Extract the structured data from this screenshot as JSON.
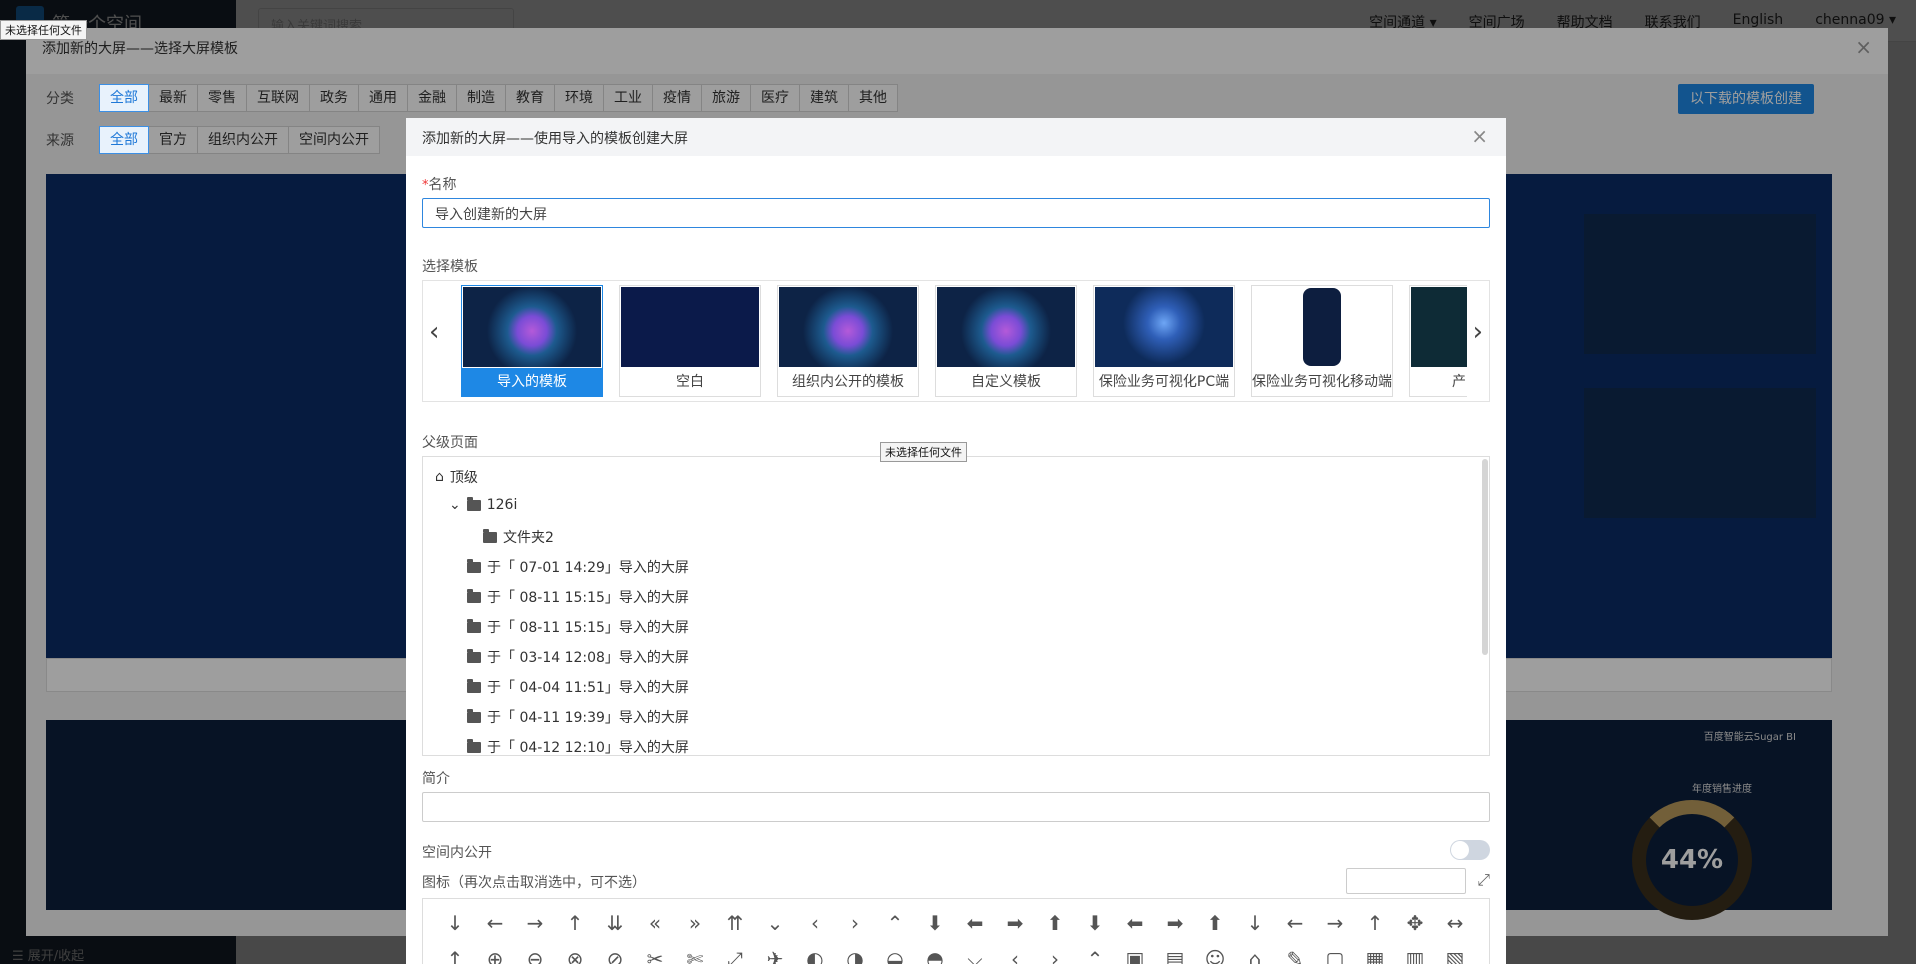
{
  "tooltip_file": "未选择任何文件",
  "app": {
    "space_title": "第一个空间",
    "search_placeholder": "输入关键词搜索",
    "nav": [
      "空间通道 ▾",
      "空间广场",
      "帮助文档",
      "联系我们",
      "English",
      "chenna09 ▾"
    ],
    "collapse": "展开/收起"
  },
  "outer": {
    "title": "添加新的大屏——选择大屏模板",
    "close": "×",
    "category_label": "分类",
    "categories": [
      "全部",
      "最新",
      "零售",
      "互联网",
      "政务",
      "通用",
      "金融",
      "制造",
      "教育",
      "环境",
      "工业",
      "疫情",
      "旅游",
      "医疗",
      "建筑",
      "其他"
    ],
    "source_label": "来源",
    "sources": [
      "全部",
      "官方",
      "组织内公开",
      "空间内公开"
    ],
    "download_button": "以下载的模板创建",
    "donut_value": "44%",
    "donut_title": "年度销售进度",
    "brand": "百度智能云Sugar BI"
  },
  "inner": {
    "title": "添加新的大屏——使用导入的模板创建大屏",
    "close": "×",
    "name_label": "名称",
    "name_value": "导入创建新的大屏",
    "template_label": "选择模板",
    "templates": [
      "导入的模板",
      "空白",
      "组织内公开的模板",
      "自定义模板",
      "保险业务可视化PC端",
      "保险业务可视化移动端",
      "产品项目"
    ],
    "parent_label": "父级页面",
    "tree": {
      "root": "顶级",
      "folder": "126i",
      "sub": "文件夹2",
      "items": [
        "于「 07-01 14:29」导入的大屏",
        "于「 08-11 15:15」导入的大屏",
        "于「 08-11 15:15」导入的大屏",
        "于「 03-14 12:08」导入的大屏",
        "于「 04-04 11:51」导入的大屏",
        "于「 04-11 19:39」导入的大屏",
        "于「 04-12 12:10」导入的大屏"
      ]
    },
    "desc_label": "简介",
    "space_public_label": "空间内公开",
    "icon_label": "图标（再次点击取消选中，可不选）",
    "icons_row1": [
      "↓",
      "←",
      "→",
      "↑",
      "⇊",
      "«",
      "»",
      "⇈",
      "⌄",
      "‹",
      "›",
      "⌃",
      "⬇",
      "⬅",
      "➡",
      "⬆",
      "⬇",
      "⬅",
      "➡",
      "⬆",
      "↓",
      "←",
      "→",
      "↑",
      "✥",
      "↔"
    ],
    "icons_row2": [
      "↥",
      "⊕",
      "⊖",
      "⊗",
      "⊘",
      "✂",
      "✄",
      "⤢",
      "✈",
      "◐",
      "◑",
      "◒",
      "◓",
      "⌵",
      "‹",
      "›",
      "⌃",
      "▣",
      "▤",
      "☺",
      "⌂",
      "✎",
      "▢",
      "▦",
      "▥",
      "▧"
    ]
  }
}
